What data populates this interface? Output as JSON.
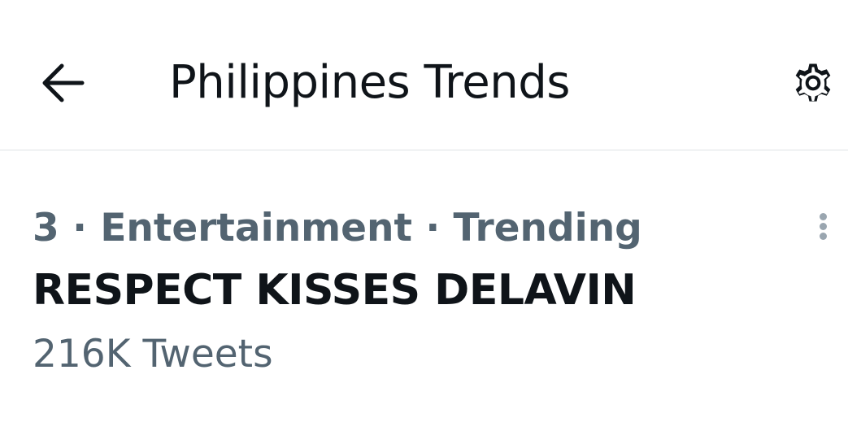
{
  "header": {
    "title": "Philippines Trends",
    "back_icon": "arrow-left-icon",
    "settings_icon": "gear-icon"
  },
  "trend": {
    "rank": "3",
    "separator": "·",
    "category": "Entertainment",
    "status": "Trending",
    "name": "RESPECT KISSES DELAVIN",
    "tweet_count": "216K Tweets",
    "more_icon": "more-vertical-icon"
  },
  "colors": {
    "primary_text": "#0f1419",
    "secondary_text": "#536471",
    "divider": "#dfe3e6",
    "background": "#ffffff"
  }
}
